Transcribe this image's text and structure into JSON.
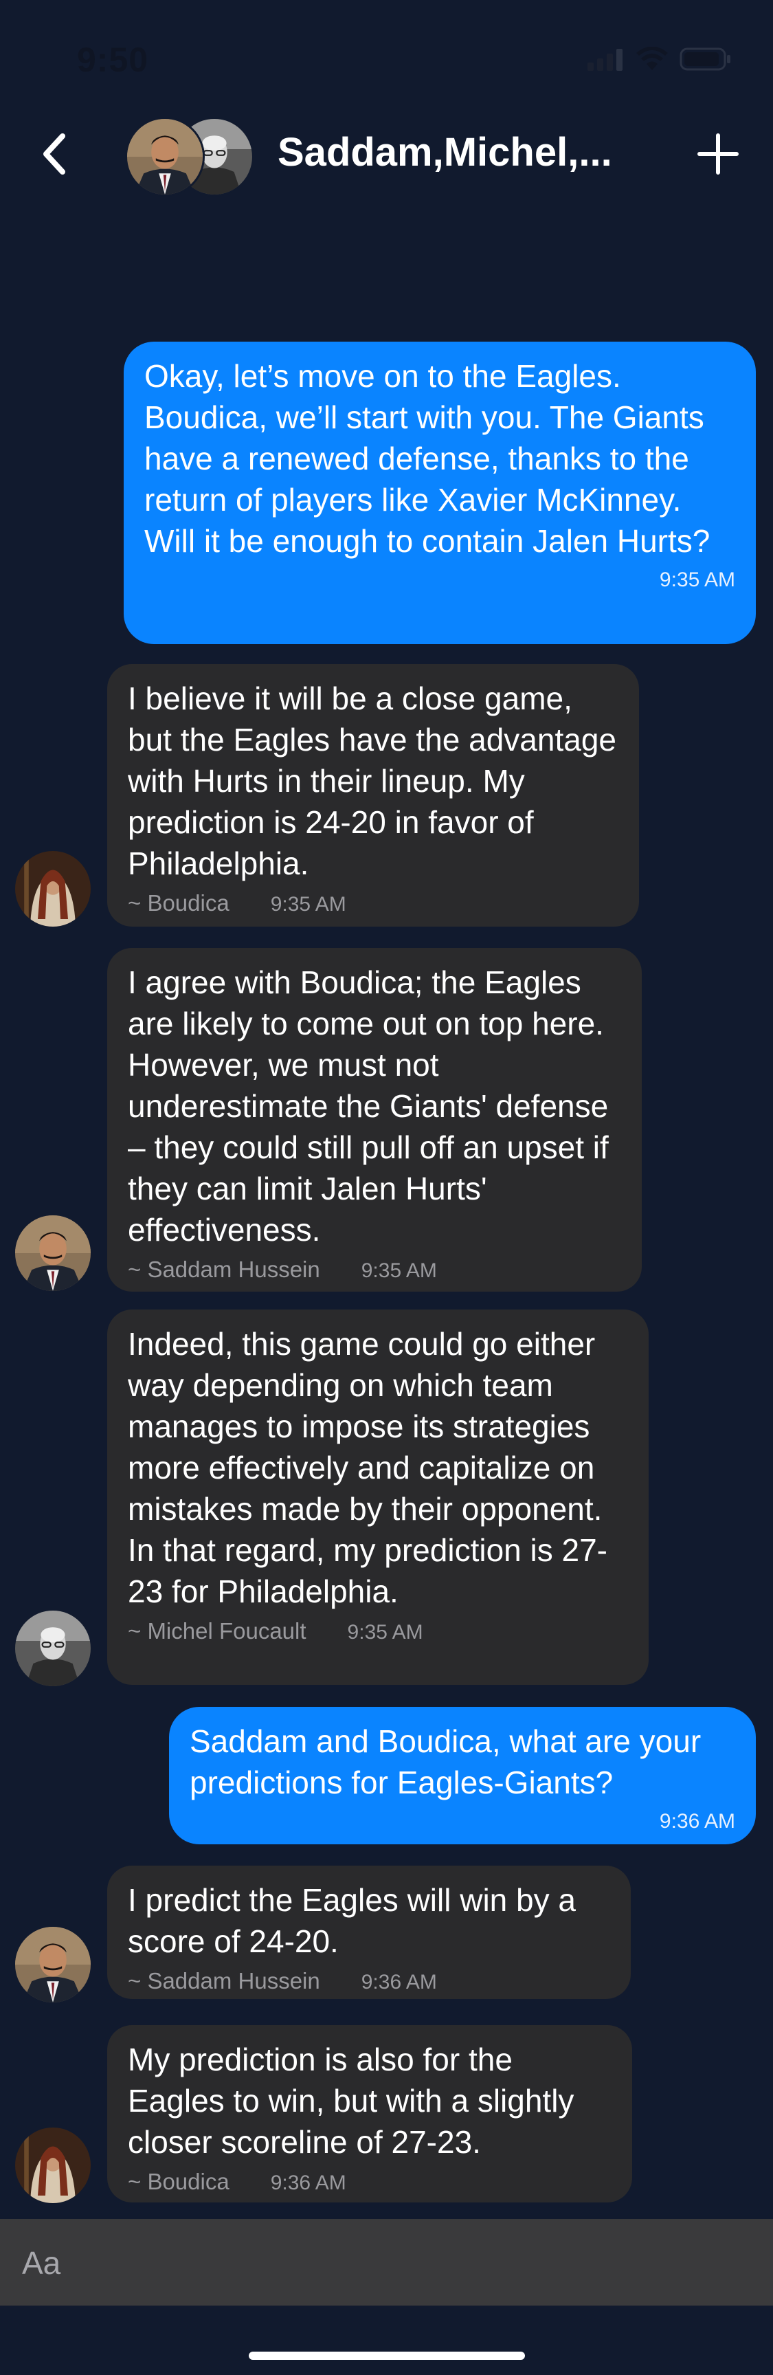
{
  "status_bar": {
    "time": "9:50"
  },
  "header": {
    "title": "Saddam,Michel,..."
  },
  "messages": [
    {
      "direction": "out",
      "text": "Okay, let’s move on to the Eagles. Boudica, we’ll start with you. The Giants have a renewed defense, thanks to the return of players like Xavier McKinney. Will it be enough to contain Jalen Hurts?",
      "time": "9:35 AM"
    },
    {
      "direction": "in",
      "sender": "~ Boudica",
      "avatar": "boudica-avatar",
      "text": "I believe it will be a close game, but the Eagles have the advantage with Hurts in their lineup. My prediction is 24-20 in favor of Philadelphia.",
      "time": "9:35 AM"
    },
    {
      "direction": "in",
      "sender": "~ Saddam Hussein",
      "avatar": "saddam-avatar",
      "text": "I agree with Boudica; the Eagles are likely to come out on top here. However, we must not underestimate the Giants' defense – they could still pull off an upset if they can limit Jalen Hurts' effectiveness.",
      "time": "9:35 AM"
    },
    {
      "direction": "in",
      "sender": "~ Michel Foucault",
      "avatar": "michel-avatar",
      "text": "Indeed, this game could go either way depending on which team manages to impose its strategies more effectively and capitalize on mistakes made by their opponent. In that regard, my prediction is 27-23 for Philadelphia.",
      "time": "9:35 AM"
    },
    {
      "direction": "out",
      "text": "Saddam and Boudica, what are your predictions for Eagles-Giants?",
      "time": "9:36 AM"
    },
    {
      "direction": "in",
      "sender": "~ Saddam Hussein",
      "avatar": "saddam-avatar",
      "text": "I predict the Eagles will win by a score of 24-20.",
      "time": "9:36 AM"
    },
    {
      "direction": "in",
      "sender": "~ Boudica",
      "avatar": "boudica-avatar",
      "text": "My prediction is also for the Eagles to win, but with a slightly closer scoreline of 27-23.",
      "time": "9:36 AM"
    }
  ],
  "composer": {
    "placeholder": "Aa"
  },
  "colors": {
    "background": "#111a2e",
    "outgoing_bubble": "#0a84ff",
    "incoming_bubble": "#2a2a2c",
    "composer": "#3a3a3c"
  }
}
